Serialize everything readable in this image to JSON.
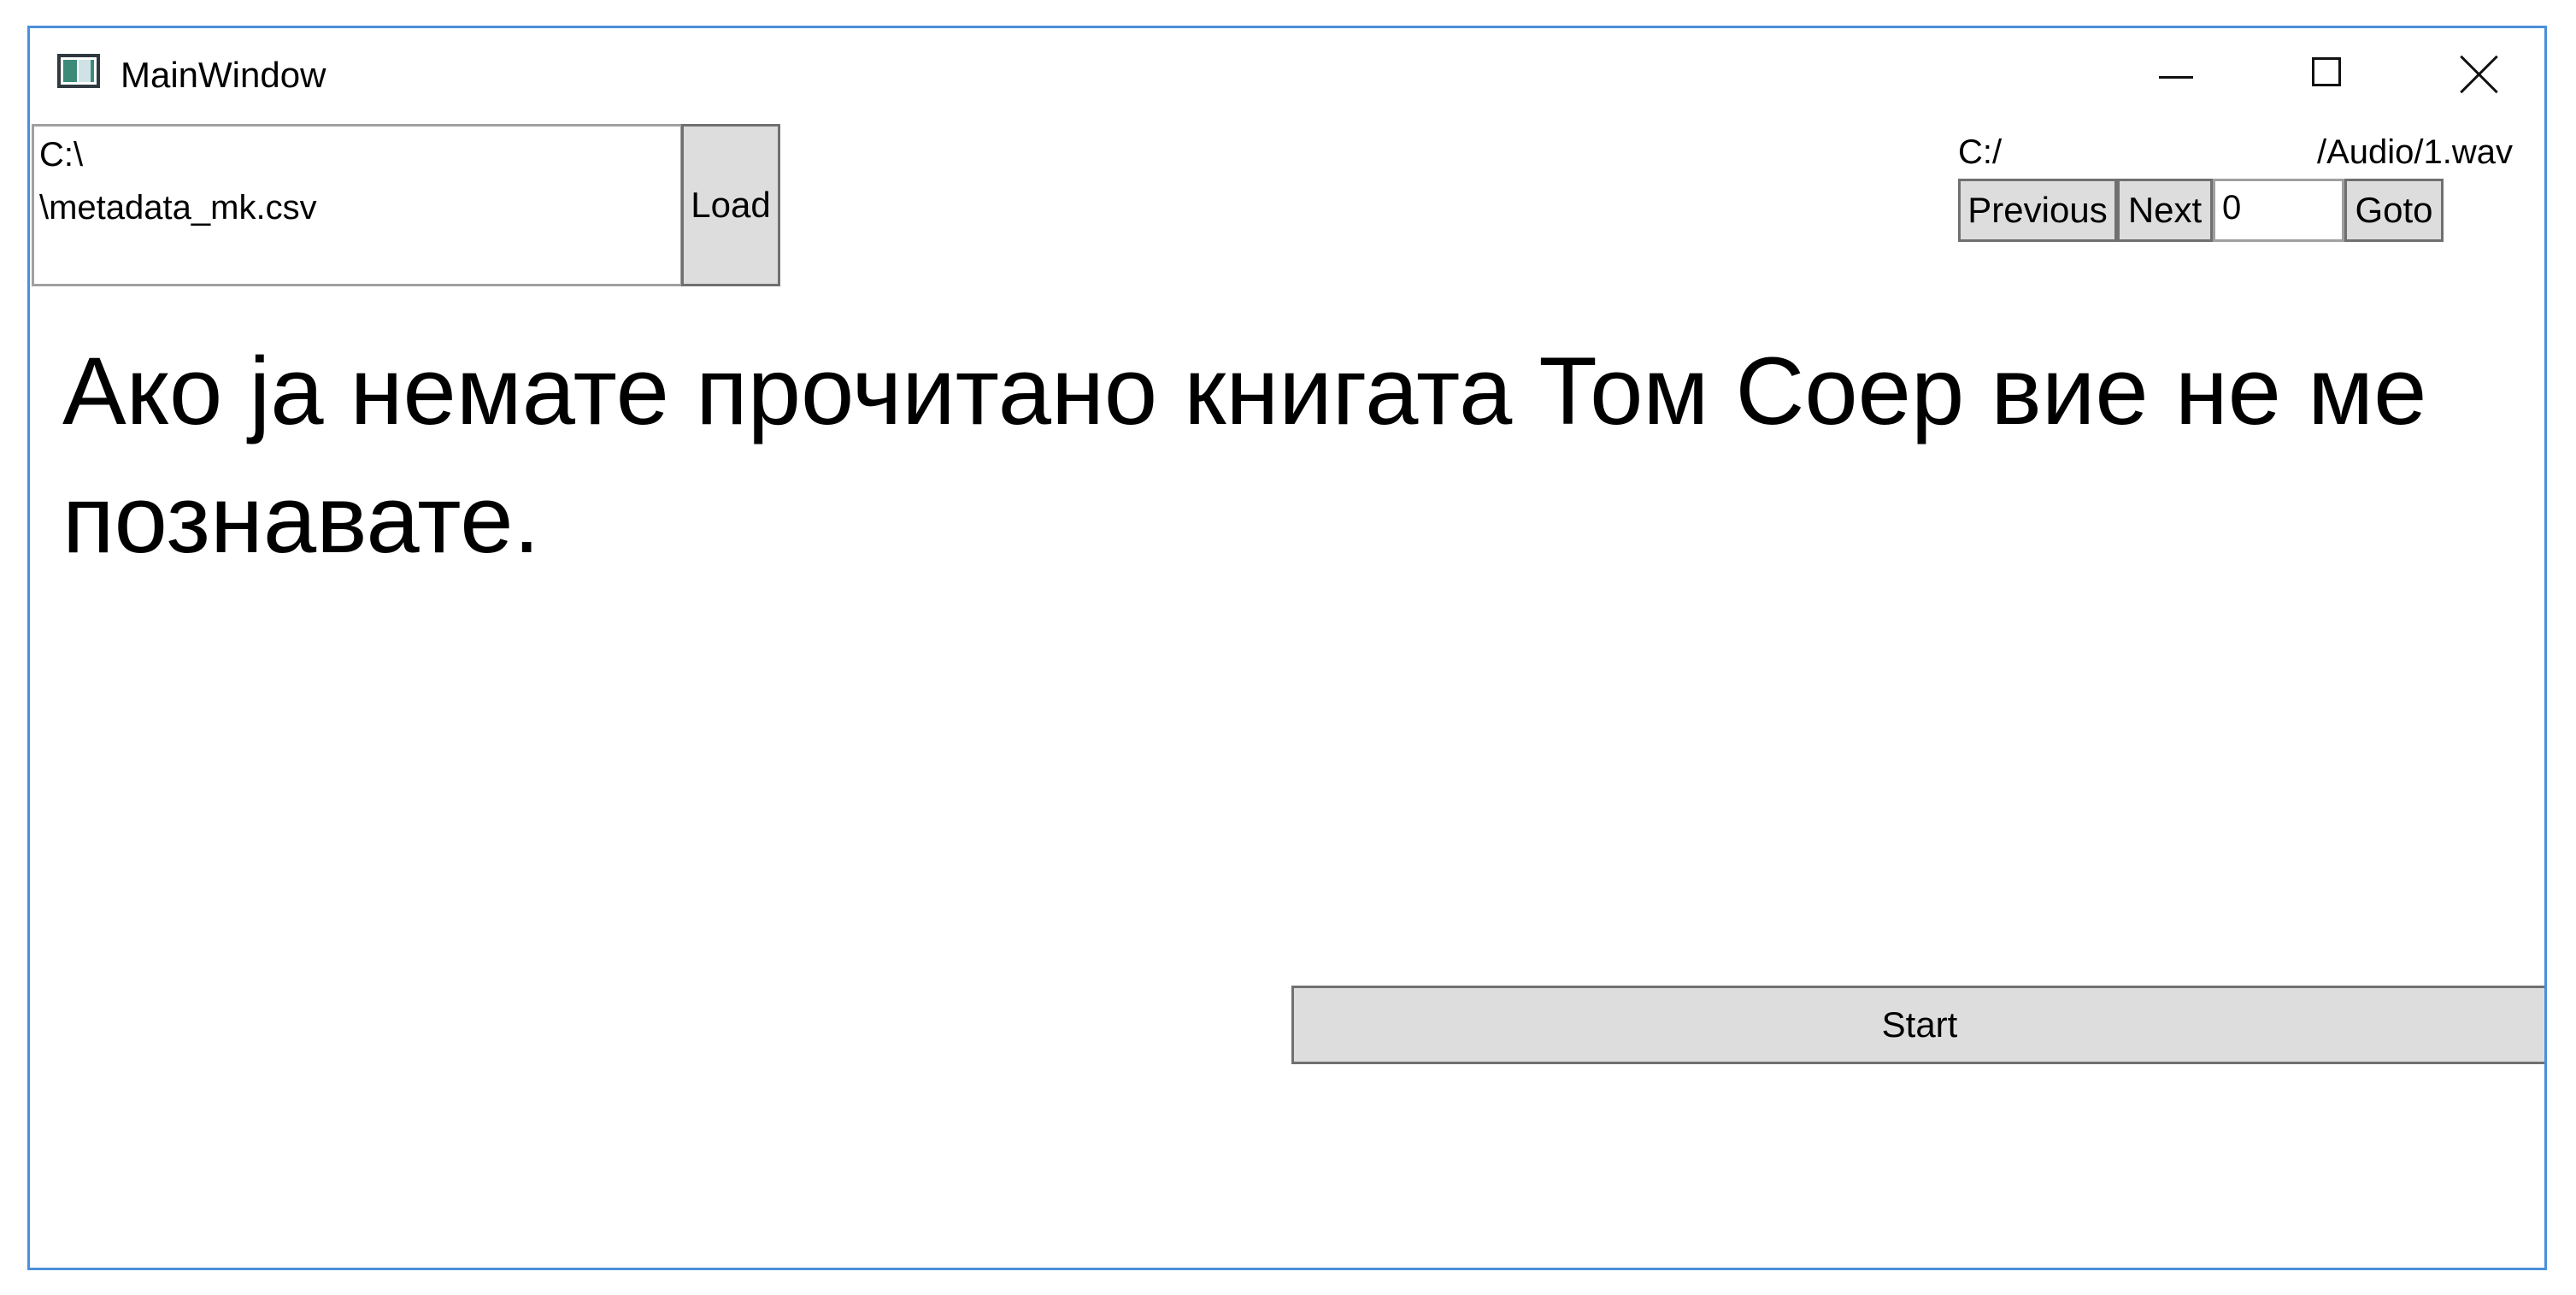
{
  "window": {
    "title": "MainWindow",
    "icon": "app-window-icon",
    "controls": {
      "minimize_icon": "minimize-icon",
      "maximize_icon": "maximize-icon",
      "close_icon": "close-icon"
    }
  },
  "metadata": {
    "path_value": "C:\\\n\\metadata_mk.csv",
    "load_label": "Load"
  },
  "audio": {
    "path_left": "C:/",
    "path_right": "/Audio/1.wav",
    "previous_label": "Previous",
    "next_label": "Next",
    "index_value": "0",
    "goto_label": "Goto"
  },
  "sentence": {
    "text": "Ако ја немате прочитано книгата Том Соер вие не ме познавате."
  },
  "actions": {
    "start_label": "Start"
  },
  "colors": {
    "window_border": "#4a90d9",
    "button_bg": "#dddddd",
    "button_border": "#707070"
  }
}
